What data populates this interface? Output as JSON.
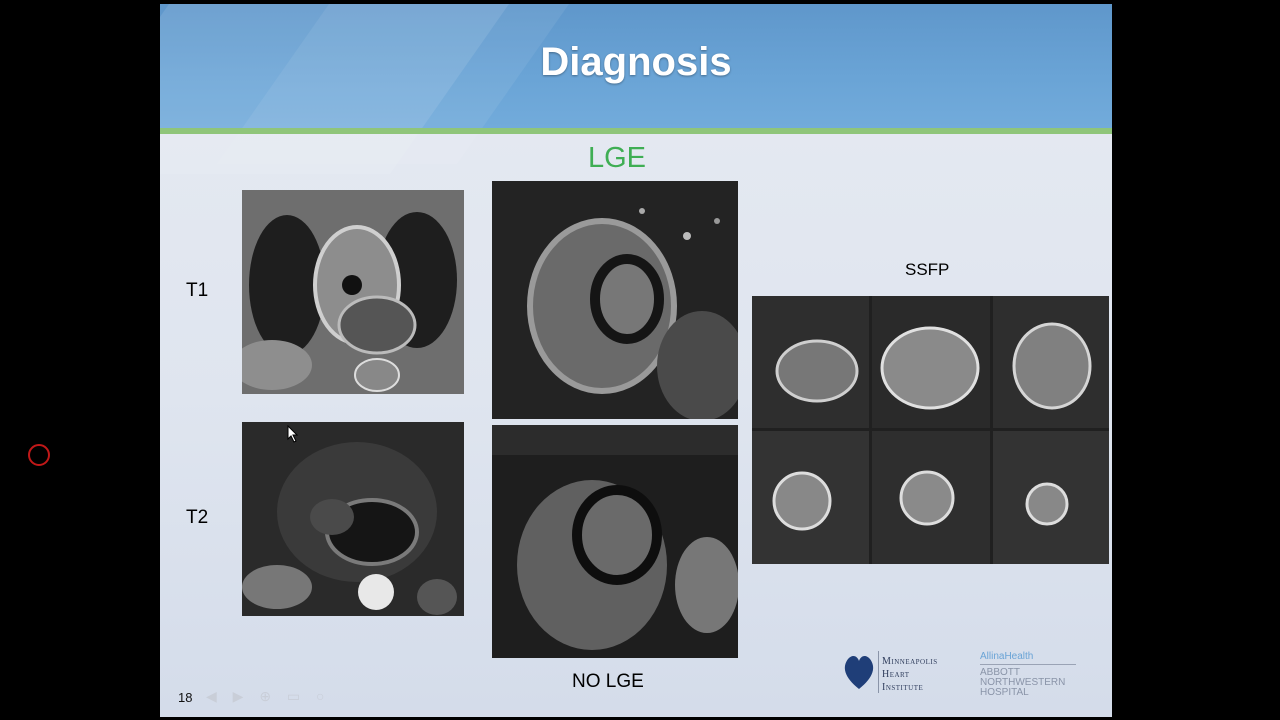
{
  "slide": {
    "title": "Diagnosis",
    "lge_heading": "LGE",
    "labels": {
      "t1": "T1",
      "t2": "T2",
      "ssfp": "SSFP",
      "no_lge": "NO LGE"
    },
    "page_number": "18",
    "nav_controls": "◀ ▶ ⊕ ▭ ○"
  },
  "logos": {
    "minneapolis": {
      "line1": "Minneapolis",
      "line2": "Heart",
      "line3": "Institute"
    },
    "allina": {
      "brand": "AllinaHealth",
      "line1": "ABBOTT",
      "line2": "NORTHWESTERN",
      "line3": "HOSPITAL"
    }
  },
  "colors": {
    "banner": "#6aa4d6",
    "rule": "#8fc57a",
    "lge": "#3fae54",
    "record": "#c01818"
  }
}
